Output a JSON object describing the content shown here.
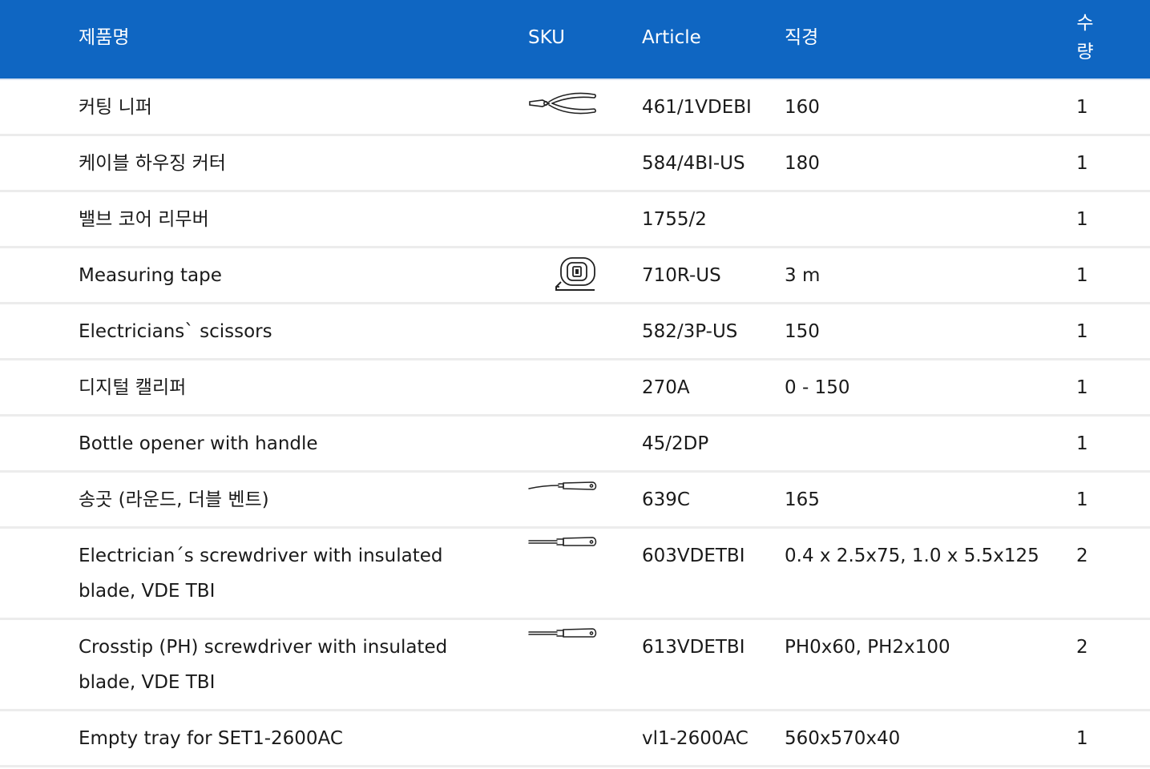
{
  "header": {
    "name": "제품명",
    "sku": "SKU",
    "article": "Article",
    "diameter": "직경",
    "quantity": "수량"
  },
  "rows": [
    {
      "name": "커팅 니퍼",
      "icon": "pliers-icon",
      "article": "461/1VDEBI",
      "diameter": "160",
      "quantity": "1"
    },
    {
      "name": "케이블 하우징 커터",
      "icon": "",
      "article": "584/4BI-US",
      "diameter": "180",
      "quantity": "1"
    },
    {
      "name": "밸브 코어 리무버",
      "icon": "",
      "article": "1755/2",
      "diameter": "",
      "quantity": "1"
    },
    {
      "name": "Measuring tape",
      "icon": "measuring-tape-icon",
      "article": "710R-US",
      "diameter": "3 m",
      "quantity": "1"
    },
    {
      "name": "Electricians` scissors",
      "icon": "",
      "article": "582/3P-US",
      "diameter": "150",
      "quantity": "1"
    },
    {
      "name": "디지털 캘리퍼",
      "icon": "",
      "article": "270A",
      "diameter": "0 - 150",
      "quantity": "1"
    },
    {
      "name": "Bottle opener with handle",
      "icon": "",
      "article": "45/2DP",
      "diameter": "",
      "quantity": "1"
    },
    {
      "name": "송곳 (라운드, 더블 벤트)",
      "icon": "awl-icon",
      "article": "639C",
      "diameter": "165",
      "quantity": "1"
    },
    {
      "name": "Electrician´s screwdriver with insulated blade, VDE TBI",
      "icon": "screwdriver-icon",
      "article": "603VDETBI",
      "diameter": "0.4 x 2.5x75, 1.0 x 5.5x125",
      "quantity": "2"
    },
    {
      "name": "Crosstip (PH) screwdriver with insulated blade, VDE TBI",
      "icon": "crosstip-screwdriver-icon",
      "article": "613VDETBI",
      "diameter": "PH0x60, PH2x100",
      "quantity": "2"
    },
    {
      "name": "Empty tray for SET1-2600AC",
      "icon": "",
      "article": "vl1-2600AC",
      "diameter": "560x570x40",
      "quantity": "1"
    }
  ]
}
